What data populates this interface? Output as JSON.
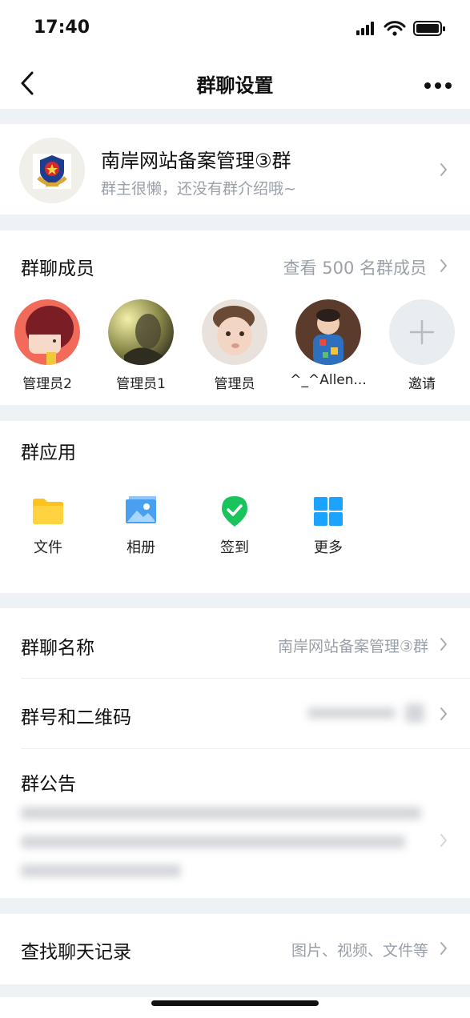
{
  "status": {
    "time": "17:40"
  },
  "nav": {
    "title": "群聊设置"
  },
  "group": {
    "name": "南岸网站备案管理③群",
    "intro": "群主很懒，还没有群介绍哦~"
  },
  "members": {
    "title": "群聊成员",
    "view_all": "查看 500 名群成员",
    "list": [
      {
        "name": "管理员2"
      },
      {
        "name": "管理员1"
      },
      {
        "name": "管理员"
      },
      {
        "name": "^_^Allen..."
      }
    ],
    "invite_label": "邀请"
  },
  "apps": {
    "title": "群应用",
    "items": [
      {
        "label": "文件",
        "icon": "folder-icon"
      },
      {
        "label": "相册",
        "icon": "photo-album-icon"
      },
      {
        "label": "签到",
        "icon": "check-in-icon"
      },
      {
        "label": "更多",
        "icon": "more-grid-icon"
      }
    ]
  },
  "settings": {
    "group_name_label": "群聊名称",
    "group_name_value": "南岸网站备案管理③群",
    "group_number_label": "群号和二维码",
    "announcement_label": "群公告"
  },
  "search": {
    "label": "查找聊天记录",
    "value": "图片、视频、文件等"
  },
  "colors": {
    "accent_blue": "#1aa3ff",
    "folder_yellow": "#ffc21a",
    "checkin_green": "#19c45c",
    "secondary_text": "#9aa0a8"
  }
}
